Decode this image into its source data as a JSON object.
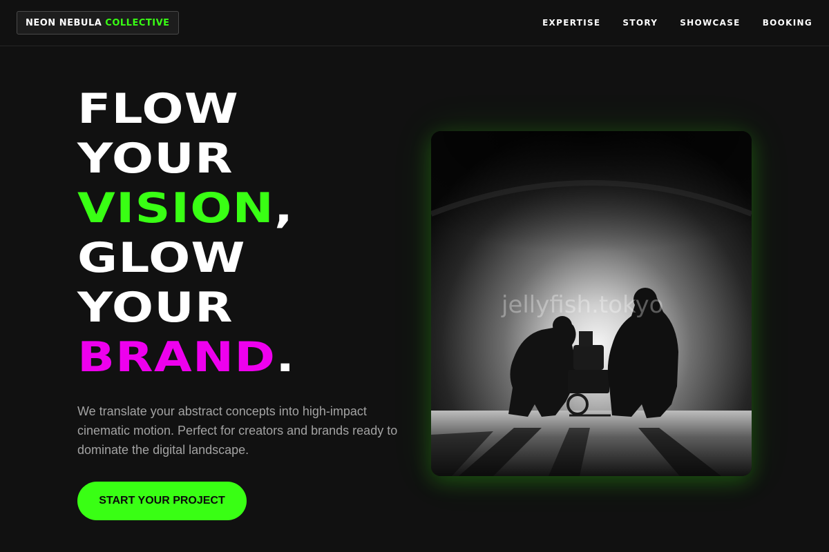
{
  "brand": {
    "name_part1": "NEON NEBULA",
    "name_part2": "COLLECTIVE"
  },
  "nav": {
    "items": [
      {
        "label": "EXPERTISE"
      },
      {
        "label": "STORY"
      },
      {
        "label": "SHOWCASE"
      },
      {
        "label": "BOOKING"
      }
    ]
  },
  "hero": {
    "headline": {
      "line1": "FLOW",
      "line2": "YOUR",
      "line3_highlight": "VISION",
      "line3_punct": ",",
      "line4": "GLOW",
      "line5": "YOUR",
      "line6_highlight": "BRAND",
      "line6_punct": "."
    },
    "description": "We translate your abstract concepts into high-impact cinematic motion. Perfect for creators and brands ready to dominate the digital landscape.",
    "cta_label": "START YOUR PROJECT"
  },
  "media": {
    "watermark": "jellyfish.tokyo"
  },
  "colors": {
    "background": "#111111",
    "accent_green": "#39ff14",
    "accent_magenta": "#ee00ee",
    "text_primary": "#ffffff",
    "text_muted": "#a3a3a3"
  }
}
